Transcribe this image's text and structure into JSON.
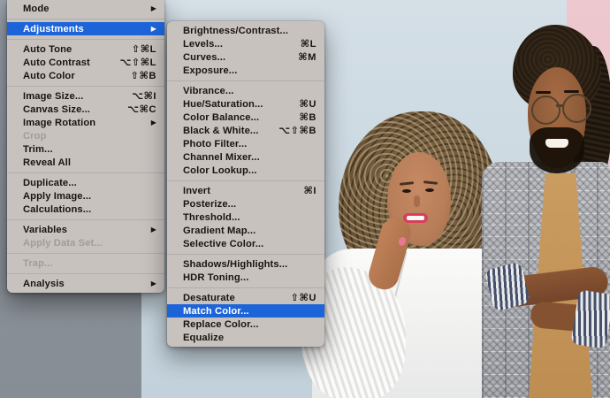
{
  "colors": {
    "menu_background": "#c8c2bf",
    "menu_text": "#17150f",
    "menu_disabled_text": "#a29c99",
    "selection_blue": "#1e64d9",
    "separator": "#b2acaa",
    "photo_wall_blue": "#cdd9e2",
    "photo_wall_gray": "#8b9199",
    "photo_pink_panel": "#eac5cb"
  },
  "icons": {
    "submenu_arrow": "▶"
  },
  "menus": {
    "image": {
      "name": "Image menu",
      "items": [
        {
          "label": "Mode",
          "has_submenu": true
        },
        {
          "type": "separator"
        },
        {
          "label": "Adjustments",
          "has_submenu": true,
          "selected": true
        },
        {
          "type": "separator"
        },
        {
          "label": "Auto Tone",
          "shortcut": "⇧⌘L"
        },
        {
          "label": "Auto Contrast",
          "shortcut": "⌥⇧⌘L"
        },
        {
          "label": "Auto Color",
          "shortcut": "⇧⌘B"
        },
        {
          "type": "separator"
        },
        {
          "label": "Image Size...",
          "shortcut": "⌥⌘I"
        },
        {
          "label": "Canvas Size...",
          "shortcut": "⌥⌘C"
        },
        {
          "label": "Image Rotation",
          "has_submenu": true
        },
        {
          "label": "Crop",
          "disabled": true
        },
        {
          "label": "Trim..."
        },
        {
          "label": "Reveal All"
        },
        {
          "type": "separator"
        },
        {
          "label": "Duplicate..."
        },
        {
          "label": "Apply Image..."
        },
        {
          "label": "Calculations..."
        },
        {
          "type": "separator"
        },
        {
          "label": "Variables",
          "has_submenu": true
        },
        {
          "label": "Apply Data Set...",
          "disabled": true
        },
        {
          "type": "separator"
        },
        {
          "label": "Trap...",
          "disabled": true
        },
        {
          "type": "separator"
        },
        {
          "label": "Analysis",
          "has_submenu": true
        }
      ]
    },
    "adjustments": {
      "name": "Adjustments submenu",
      "items": [
        {
          "label": "Brightness/Contrast..."
        },
        {
          "label": "Levels...",
          "shortcut": "⌘L"
        },
        {
          "label": "Curves...",
          "shortcut": "⌘M"
        },
        {
          "label": "Exposure..."
        },
        {
          "type": "separator"
        },
        {
          "label": "Vibrance..."
        },
        {
          "label": "Hue/Saturation...",
          "shortcut": "⌘U"
        },
        {
          "label": "Color Balance...",
          "shortcut": "⌘B"
        },
        {
          "label": "Black & White...",
          "shortcut": "⌥⇧⌘B"
        },
        {
          "label": "Photo Filter..."
        },
        {
          "label": "Channel Mixer..."
        },
        {
          "label": "Color Lookup..."
        },
        {
          "type": "separator"
        },
        {
          "label": "Invert",
          "shortcut": "⌘I"
        },
        {
          "label": "Posterize..."
        },
        {
          "label": "Threshold..."
        },
        {
          "label": "Gradient Map..."
        },
        {
          "label": "Selective Color..."
        },
        {
          "type": "separator"
        },
        {
          "label": "Shadows/Highlights..."
        },
        {
          "label": "HDR Toning..."
        },
        {
          "type": "separator"
        },
        {
          "label": "Desaturate",
          "shortcut": "⇧⌘U"
        },
        {
          "label": "Match Color...",
          "selected": true
        },
        {
          "label": "Replace Color..."
        },
        {
          "label": "Equalize"
        }
      ]
    }
  }
}
